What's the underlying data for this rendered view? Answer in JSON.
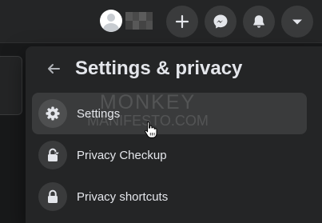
{
  "topbar": {
    "icons": {
      "avatar": "default-avatar",
      "create": "plus-icon",
      "messenger": "messenger-icon",
      "notifications": "bell-icon",
      "account": "caret-down-icon"
    }
  },
  "panel": {
    "back_icon": "arrow-left-icon",
    "title": "Settings & privacy",
    "items": [
      {
        "label": "Settings",
        "icon": "gear-icon"
      },
      {
        "label": "Privacy Checkup",
        "icon": "lock-heart-icon"
      },
      {
        "label": "Privacy shortcuts",
        "icon": "lock-icon"
      }
    ]
  },
  "watermark": {
    "line1": "MONKEY",
    "line2": "MANIFESTO.COM"
  },
  "colors": {
    "background": "#18191a",
    "surface": "#242526",
    "hover": "#3a3b3c",
    "text": "#e4e6eb"
  }
}
